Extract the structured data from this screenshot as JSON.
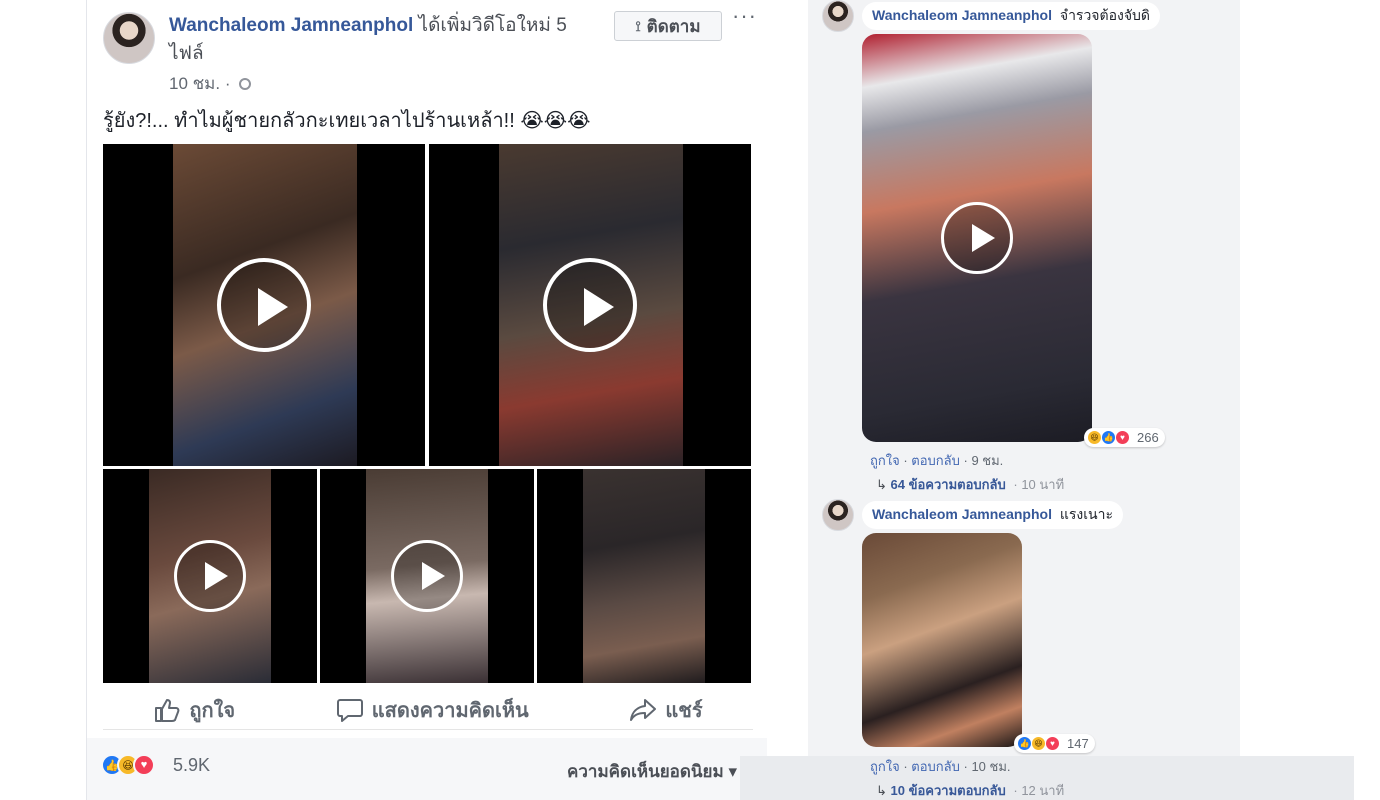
{
  "post": {
    "author_name": "Wanchaleom Jamneanphol",
    "author_action": "ได้เพิ่มวิดีโอใหม่ 5 ไฟล์",
    "time": "10 ชม. ·",
    "follow_label": "ติดตาม",
    "more_label": "···",
    "text": "รู้ยัง?!... ทำไมผู้ชายกลัวกะเทยเวลาไปร้านเหล้า!! 😭😭😭",
    "videos_count": 5,
    "actions": {
      "like": "ถูกใจ",
      "comment": "แสดงความคิดเห็น",
      "share": "แชร์"
    },
    "reaction_icons": [
      "like-icon",
      "haha-icon",
      "love-icon"
    ],
    "reaction_count": "5.9K",
    "sort_label": "ความคิดเห็นยอดนิยม ▾"
  },
  "comments": [
    {
      "name": "Wanchaleom Jamneanphol",
      "text": "จำรวจต้องจับดิ",
      "reaction_icons": [
        "haha-icon",
        "like-icon",
        "love-icon"
      ],
      "reaction_count": "266",
      "like_label": "ถูกใจ",
      "reply_label": "ตอบกลับ",
      "time": "9 ชม.",
      "replies_count": "64 ข้อความตอบกลับ",
      "replies_ago": "· 10 นาที"
    },
    {
      "name": "Wanchaleom Jamneanphol",
      "text": "แรงเนาะ",
      "reaction_icons": [
        "like-icon",
        "haha-icon",
        "love-icon"
      ],
      "reaction_count": "147",
      "like_label": "ถูกใจ",
      "reply_label": "ตอบกลับ",
      "time": "10 ชม.",
      "replies_count": "10 ข้อความตอบกลับ",
      "replies_ago": "· 12 นาที"
    }
  ],
  "colors": {
    "name_link": "#365899",
    "like_blue": "#2078f4",
    "love_red": "#f33e58",
    "haha_yellow": "#f7b928",
    "panel_gray": "#f2f3f5"
  }
}
